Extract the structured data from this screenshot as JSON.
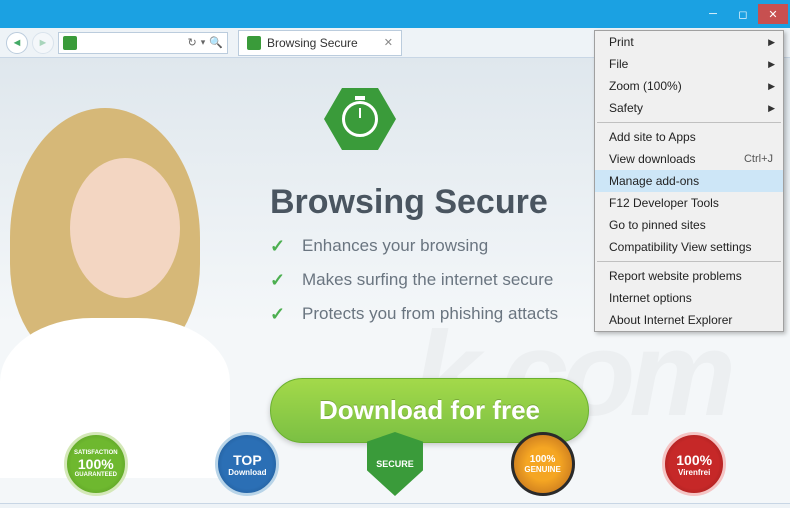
{
  "window": {
    "tab_title": "Browsing Secure"
  },
  "page": {
    "headline": "Browsing Secure",
    "features": [
      "Enhances your browsing",
      "Makes surfing the internet secure",
      "Protects you from phishing attacts"
    ],
    "cta_label": "Download for free",
    "watermark": "k.com",
    "badges": [
      {
        "line1": "SATISFACTION",
        "line2": "100%",
        "line3": "GUARANTEED"
      },
      {
        "line1": "TOP",
        "line2": "Download",
        "line3": ""
      },
      {
        "line1": "",
        "line2": "SECURE",
        "line3": ""
      },
      {
        "line1": "100%",
        "line2": "GENUINE",
        "line3": ""
      },
      {
        "line1": "100%",
        "line2": "Virenfrei",
        "line3": ""
      }
    ]
  },
  "menu": {
    "items_top": [
      {
        "label": "Print",
        "submenu": true
      },
      {
        "label": "File",
        "submenu": true
      },
      {
        "label": "Zoom (100%)",
        "submenu": true
      },
      {
        "label": "Safety",
        "submenu": true
      }
    ],
    "items_mid1": [
      {
        "label": "Add site to Apps",
        "shortcut": ""
      },
      {
        "label": "View downloads",
        "shortcut": "Ctrl+J"
      },
      {
        "label": "Manage add-ons",
        "shortcut": "",
        "hover": true
      },
      {
        "label": "F12 Developer Tools",
        "shortcut": ""
      },
      {
        "label": "Go to pinned sites",
        "shortcut": ""
      },
      {
        "label": "Compatibility View settings",
        "shortcut": ""
      }
    ],
    "items_mid2": [
      {
        "label": "Report website problems"
      },
      {
        "label": "Internet options"
      },
      {
        "label": "About Internet Explorer"
      }
    ]
  }
}
